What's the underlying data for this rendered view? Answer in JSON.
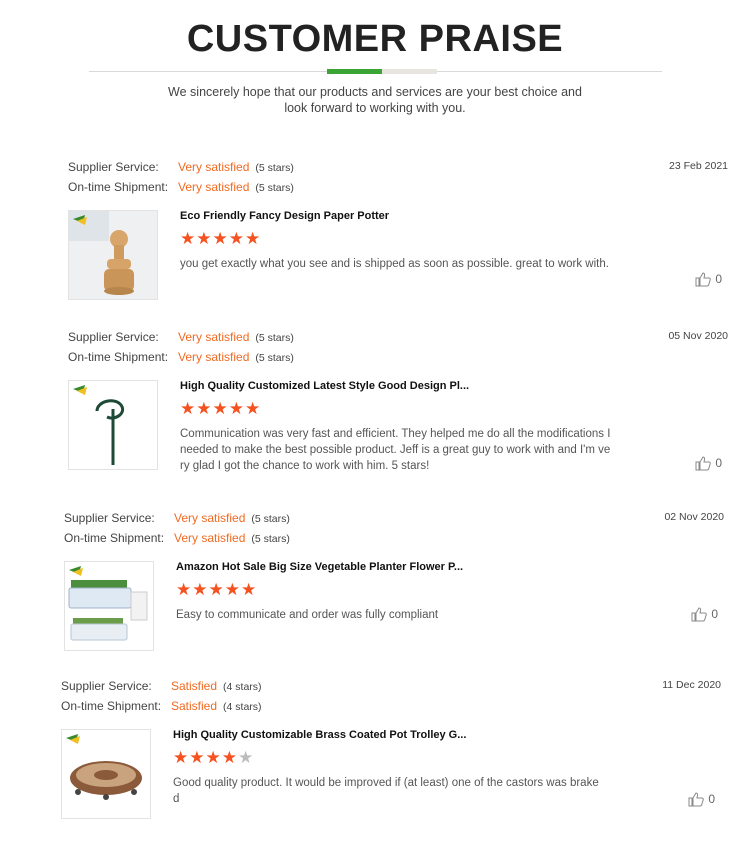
{
  "header": {
    "title": "CUSTOMER PRAISE",
    "subtitle": "We sincerely hope that our products and services are your best choice and look forward to working with you."
  },
  "labels": {
    "supplier_service": "Supplier Service:",
    "on_time_shipment": "On-time Shipment:"
  },
  "colors": {
    "accent": "#f26a21",
    "star": "#f5521f",
    "star_off": "#bdbdbd",
    "rule_green": "#3aa435"
  },
  "reviews": [
    {
      "date": "23 Feb 2021",
      "supplier_service": "Very satisfied",
      "supplier_stars": "(5 stars)",
      "on_time_shipment": "Very satisfied",
      "shipment_stars": "(5 stars)",
      "product": "Eco Friendly Fancy Design Paper Potter",
      "rating": 5,
      "comment": "you get exactly what you see and is shipped as soon as possible. great to work with.",
      "likes": "0",
      "image": "wooden-stopper-photo"
    },
    {
      "date": "05 Nov 2020",
      "supplier_service": "Very satisfied",
      "supplier_stars": "(5 stars)",
      "on_time_shipment": "Very satisfied",
      "shipment_stars": "(5 stars)",
      "product": "High Quality Customized Latest Style Good Design Pl...",
      "rating": 5,
      "comment": "Communication was very fast and efficient. They helped me do all the modifications I needed to make the best possible product. Jeff is a great guy to work with and I'm very glad I got the chance to work with him. 5 stars!",
      "likes": "0",
      "image": "plant-support-stake-photo"
    },
    {
      "date": "02 Nov 2020",
      "supplier_service": "Very satisfied",
      "supplier_stars": "(5 stars)",
      "on_time_shipment": "Very satisfied",
      "shipment_stars": "(5 stars)",
      "product": "Amazon Hot Sale Big Size Vegetable Planter Flower P...",
      "rating": 5,
      "comment": "Easy to communicate and order was fully compliant",
      "likes": "0",
      "image": "vegetable-planter-photo"
    },
    {
      "date": "11 Dec 2020",
      "supplier_service": "Satisfied",
      "supplier_stars": "(4 stars)",
      "on_time_shipment": "Satisfied",
      "shipment_stars": "(4 stars)",
      "product": "High Quality Customizable Brass Coated Pot Trolley G...",
      "rating": 4,
      "comment": "Good quality product. It would be improved if (at least) one of the castors was braked",
      "likes": "0",
      "image": "pot-trolley-photo"
    }
  ]
}
